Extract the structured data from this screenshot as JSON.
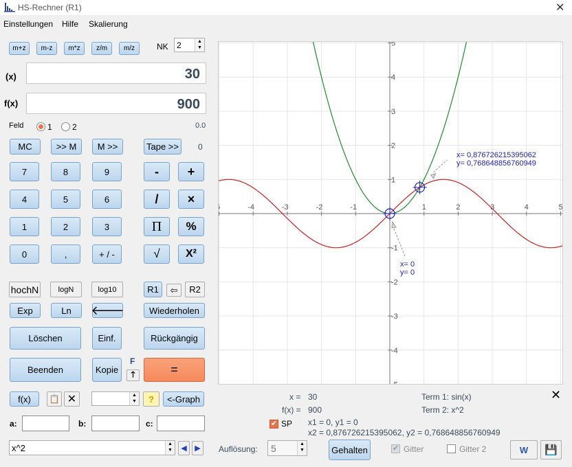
{
  "window": {
    "title": "HS-Rechner (R1)"
  },
  "menu": [
    "Einstellungen",
    "Hilfe",
    "Skalierung"
  ],
  "memory_buttons": [
    "m+z",
    "m-z",
    "m*z",
    "z/m",
    "m/z"
  ],
  "nk": {
    "label": "NK",
    "value": "2"
  },
  "x_field": {
    "label": "(x)",
    "value": "30"
  },
  "fx_field": {
    "label": "f(x)",
    "value": "900"
  },
  "feld": {
    "label": "Feld",
    "option1": "1",
    "option2": "2",
    "selected": "1",
    "right_value": "0.0"
  },
  "row_mem": {
    "mc": "MC",
    "to_m": ">> M",
    "from_m": "M >>",
    "tape": "Tape >>",
    "count": "0"
  },
  "keypad": {
    "n7": "7",
    "n8": "8",
    "n9": "9",
    "minus": "-",
    "plus": "+",
    "n4": "4",
    "n5": "5",
    "n6": "6",
    "div": "/",
    "mul": "×",
    "n1": "1",
    "n2": "2",
    "n3": "3",
    "pi": "Π",
    "pct": "%",
    "n0": "0",
    "dot": ",",
    "sign": "+ / -",
    "sqrt": "√",
    "sq": "X²"
  },
  "fn_row": {
    "hochN": "hochN",
    "logN": "log",
    "logN_sub": "N",
    "log10": "log",
    "log10_sub": "10",
    "r1": "R1",
    "r2": "R2"
  },
  "fn_row2": {
    "exp": "Exp",
    "ln": "Ln",
    "wiederholen": "Wiederholen"
  },
  "action_row": {
    "loeschen": "Löschen",
    "einf": "Einf.",
    "rueckgaengig": "Rückgängig"
  },
  "action_row2": {
    "beenden": "Beenden",
    "kopie": "Kopie",
    "f": "F",
    "equals": "="
  },
  "bottom_tools": {
    "fx": "f(x)",
    "graph": "<-Graph",
    "help": "?"
  },
  "abc": {
    "a": "a:",
    "b": "b:",
    "c": "c:"
  },
  "formula": {
    "value": "x^2"
  },
  "graph": {
    "x_ticks": [
      "-5",
      "-4",
      "-3",
      "-2",
      "-1",
      "1",
      "2",
      "3",
      "4",
      "5"
    ],
    "y_ticks": [
      "5",
      "4",
      "3",
      "2",
      "1",
      "-1",
      "-2",
      "-3",
      "-4",
      "-5"
    ],
    "colors": {
      "term1": "#cc1f1f",
      "term2": "#1e8b2e",
      "marker": "#2020c0",
      "grid": "#e6e6e6"
    },
    "annot1": {
      "x": "x= 0,876726215395062",
      "y": "y= 0,768648856760949"
    },
    "annot2": {
      "x": "x= 0",
      "y": "y= 0"
    }
  },
  "info": {
    "x_label": "x =",
    "x_value": "30",
    "fx_label": "f(x) =",
    "fx_value": "900",
    "term1": "Term 1:  sin(x)",
    "term2": "Term 2:  x^2",
    "sp_label": "SP",
    "sp_line1": "x1 = 0,   y1 = 0",
    "sp_line2": "x2 =  0,876726215395062,   y2 = 0,768648856760949"
  },
  "footer": {
    "aufloesung_label": "Auflösung:",
    "aufloesung_value": "5",
    "gehalten": "Gehalten",
    "gitter": "Gitter",
    "gitter2": "Gitter 2"
  }
}
